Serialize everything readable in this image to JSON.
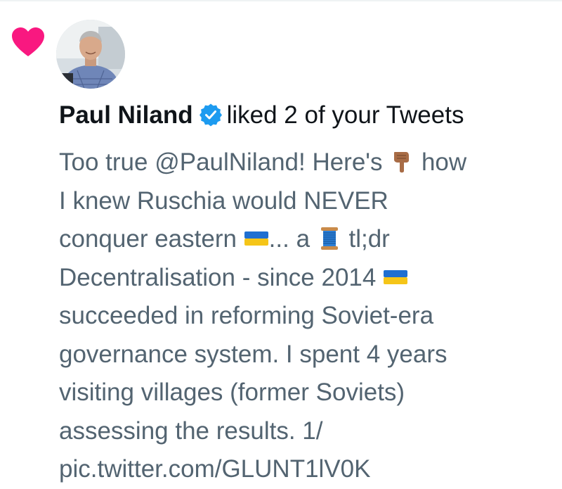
{
  "notification": {
    "actor_name": "Paul Niland",
    "action_text": "liked 2 of your Tweets",
    "icon": "heart-icon",
    "verified_icon": "verified-badge-icon",
    "tweet_lines": [
      {
        "parts": [
          {
            "t": "text",
            "v": "Too true @PaulNiland! Here's "
          },
          {
            "t": "emoji",
            "v": "backhand-index-pointing-down"
          },
          {
            "t": "text",
            "v": " how"
          }
        ]
      },
      {
        "parts": [
          {
            "t": "text",
            "v": "I knew Ruschia would NEVER"
          }
        ]
      },
      {
        "parts": [
          {
            "t": "text",
            "v": "conquer eastern "
          },
          {
            "t": "emoji",
            "v": "flag-ukraine"
          },
          {
            "t": "text",
            "v": "... a "
          },
          {
            "t": "emoji",
            "v": "spool-of-thread"
          },
          {
            "t": "text",
            "v": " tl;dr"
          }
        ]
      },
      {
        "parts": [
          {
            "t": "text",
            "v": "Decentralisation - since 2014 "
          },
          {
            "t": "emoji",
            "v": "flag-ukraine"
          }
        ]
      },
      {
        "parts": [
          {
            "t": "text",
            "v": "succeeded in reforming Soviet-era"
          }
        ]
      },
      {
        "parts": [
          {
            "t": "text",
            "v": "governance system. I spent 4 years"
          }
        ]
      },
      {
        "parts": [
          {
            "t": "text",
            "v": "visiting villages (former Soviets)"
          }
        ]
      },
      {
        "parts": [
          {
            "t": "text",
            "v": "assessing the results. 1/"
          }
        ]
      },
      {
        "parts": [
          {
            "t": "text",
            "v": "pic.twitter.com/GLUNT1lV0K"
          }
        ]
      }
    ]
  },
  "colors": {
    "heart": "#f91880",
    "verified": "#1d9bf0",
    "name_text": "#0f1419",
    "body_text": "#536471"
  }
}
